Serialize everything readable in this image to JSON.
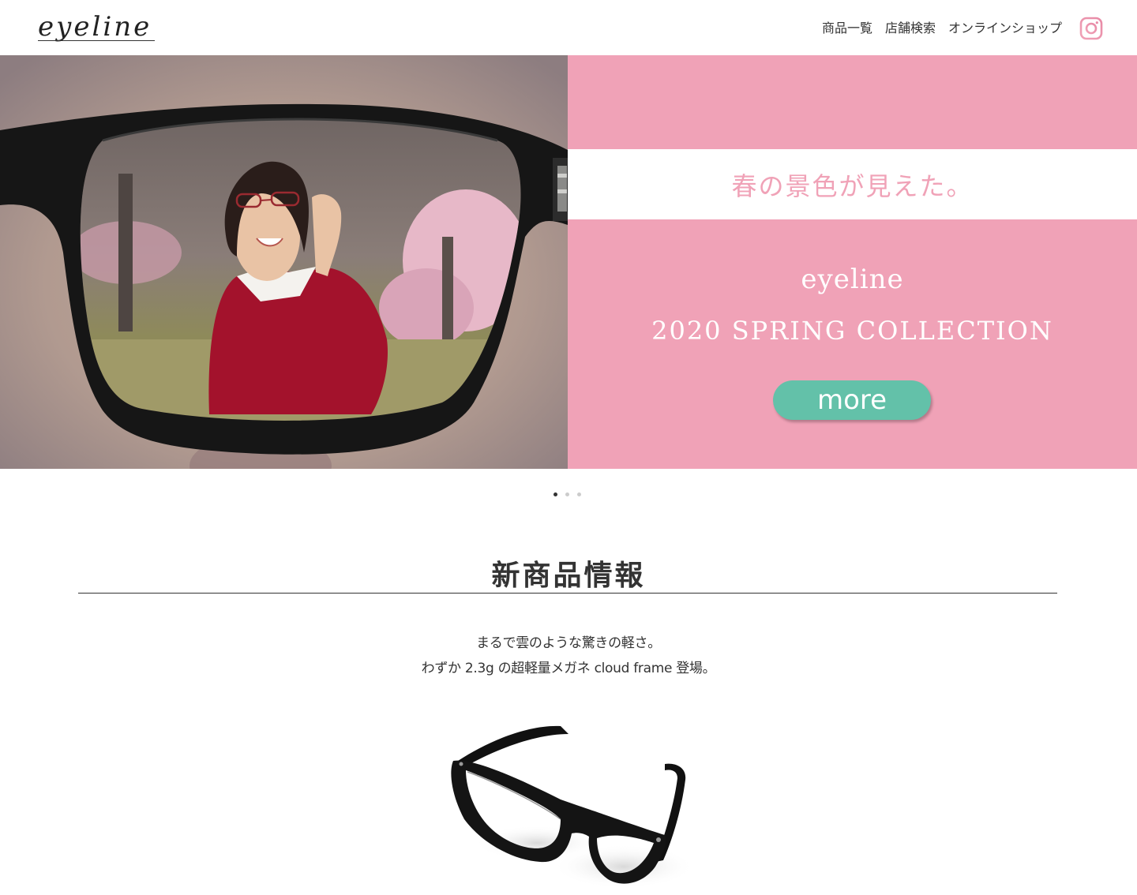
{
  "header": {
    "logo_text": "eyeline",
    "nav": [
      {
        "label": "商品一覧"
      },
      {
        "label": "店舗検索"
      },
      {
        "label": "オンラインショップ"
      }
    ],
    "instagram_icon": "instagram-icon"
  },
  "hero": {
    "tagline": "春の景色が見えた。",
    "brand": "eyeline",
    "collection": "2020 SPRING COLLECTION",
    "more_label": "more",
    "colors": {
      "panel": "#f0a2b7",
      "button": "#63c1a9",
      "tagline": "#f0a2b7"
    }
  },
  "slider": {
    "total": 3,
    "active": 1
  },
  "new_products": {
    "title": "新商品情報",
    "line1": "まるで雲のような驚きの軽さ。",
    "line2": "わずか 2.3g の超軽量メガネ cloud frame 登場。"
  }
}
